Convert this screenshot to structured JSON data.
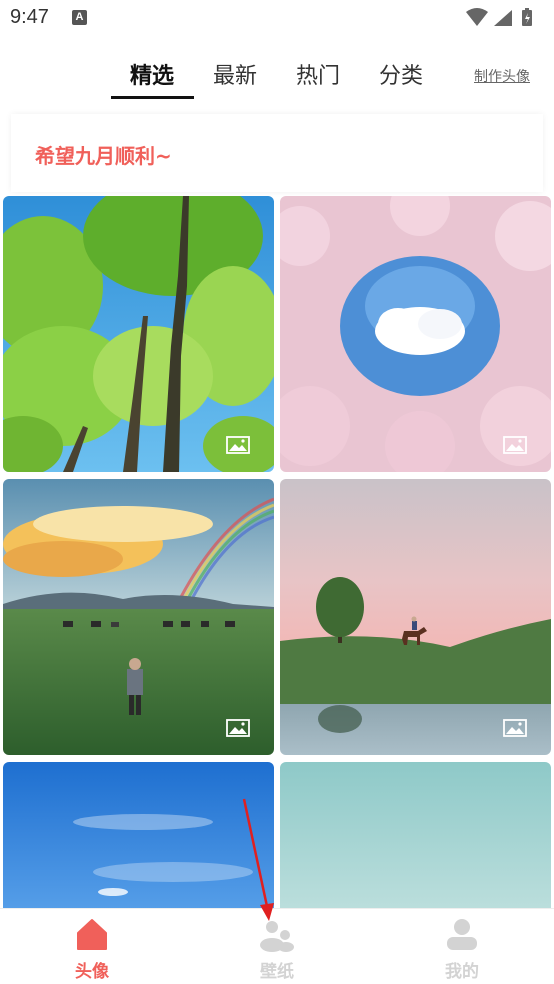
{
  "status_bar": {
    "time": "9:47",
    "badge": "A"
  },
  "tabs": {
    "items": [
      {
        "label": "精选",
        "active": true
      },
      {
        "label": "最新",
        "active": false
      },
      {
        "label": "热门",
        "active": false
      },
      {
        "label": "分类",
        "active": false
      }
    ],
    "make_avatar": "制作头像"
  },
  "banner": {
    "text": "希望九月顺利~"
  },
  "bottom_nav": {
    "items": [
      {
        "label": "头像",
        "icon": "home-icon",
        "active": true
      },
      {
        "label": "壁纸",
        "icon": "wallpaper-icon",
        "active": false
      },
      {
        "label": "我的",
        "icon": "profile-icon",
        "active": false
      }
    ]
  },
  "colors": {
    "accent": "#f0605a",
    "inactive": "#d3d3d3"
  }
}
